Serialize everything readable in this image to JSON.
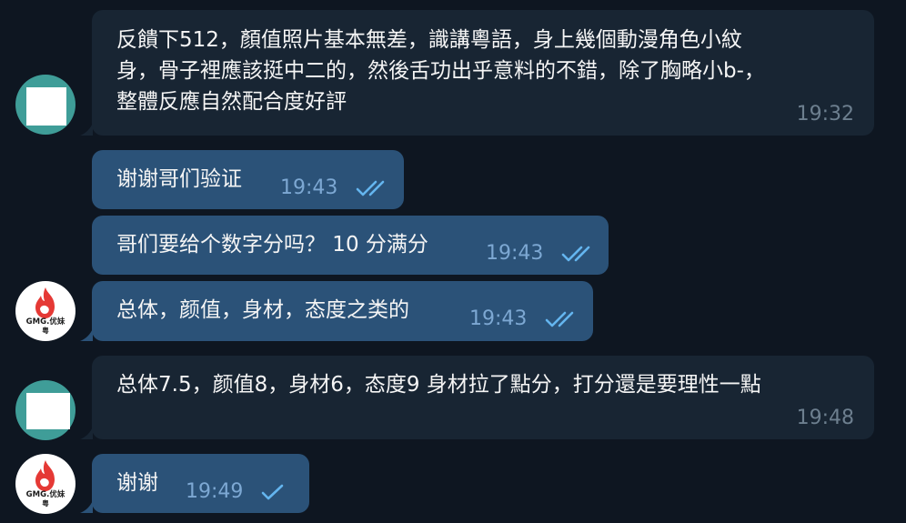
{
  "messages": [
    {
      "id": "m1",
      "direction": "in",
      "avatar": "blank",
      "lines": [
        "反饋下512，顏值照片基本無差，識講粵語，身上幾個動漫角色小紋",
        "身，骨子裡應該挺中二的，然後舌功出乎意料的不錯，除了胸略小b-，",
        "整體反應自然配合度好評"
      ],
      "time": "19:32"
    },
    {
      "id": "m2",
      "direction": "out",
      "text": "谢谢哥们验证",
      "time": "19:43",
      "status": "read"
    },
    {
      "id": "m3",
      "direction": "out",
      "text": "哥们要给个数字分吗？ 10 分满分",
      "time": "19:43",
      "status": "read"
    },
    {
      "id": "m4",
      "direction": "out",
      "avatar": "logo",
      "text": "总体，颜值，身材，态度之类的",
      "time": "19:43",
      "status": "read"
    },
    {
      "id": "m5",
      "direction": "in",
      "avatar": "blank",
      "text": "总体7.5，颜值8，身材6，态度9 身材拉了點分，打分還是要理性一點",
      "time": "19:48"
    },
    {
      "id": "m6",
      "direction": "out",
      "avatar": "logo",
      "text": "谢谢",
      "time": "19:49",
      "status": "sent"
    }
  ],
  "logo": {
    "brand": "GMG.优妹",
    "sub": "粤"
  },
  "icons": {
    "read": "double-check-icon",
    "sent": "single-check-icon",
    "logo_mark": "flame-icon"
  },
  "colors": {
    "background": "#0e1621",
    "incoming": "#182533",
    "outgoing": "#2b5278",
    "check": "#64b5ef",
    "logo_red": "#e53935"
  }
}
